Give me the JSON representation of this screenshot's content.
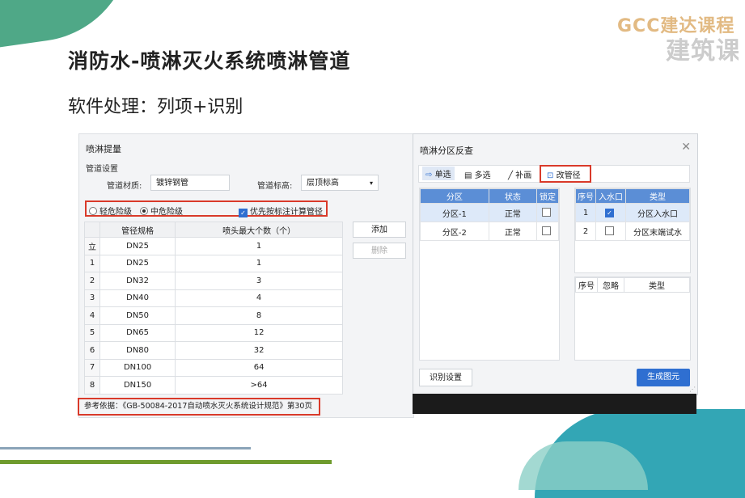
{
  "slide": {
    "title": "消防水-喷淋灭火系统喷淋管道",
    "subtitle": "软件处理：列项+识别",
    "logo_text": "GCC建达课程",
    "logo_sub": "建筑课程"
  },
  "left_dialog": {
    "title": "喷淋提量",
    "group_label": "管道设置",
    "material_label": "管道材质:",
    "material_value": "镀锌钢管",
    "elevation_label": "管道标高:",
    "elevation_value": "层顶标高",
    "hazard_light": "轻危险级",
    "hazard_medium": "中危险级",
    "priority_check": "优先按标注计算管径",
    "table_headers": [
      "管径规格",
      "喷头最大个数（个）"
    ],
    "rows": [
      {
        "idx": "立",
        "spec": "DN25",
        "count": "1"
      },
      {
        "idx": "1",
        "spec": "DN25",
        "count": "1"
      },
      {
        "idx": "2",
        "spec": "DN32",
        "count": "3"
      },
      {
        "idx": "3",
        "spec": "DN40",
        "count": "4"
      },
      {
        "idx": "4",
        "spec": "DN50",
        "count": "8"
      },
      {
        "idx": "5",
        "spec": "DN65",
        "count": "12"
      },
      {
        "idx": "6",
        "spec": "DN80",
        "count": "32"
      },
      {
        "idx": "7",
        "spec": "DN100",
        "count": "64"
      },
      {
        "idx": "8",
        "spec": "DN150",
        "count": ">64"
      }
    ],
    "add_button": "添加",
    "delete_button": "删除",
    "reference": "参考依据：《GB-50084-2017自动喷水灭火系统设计规范》第30页"
  },
  "right_dialog": {
    "title": "喷淋分区反查",
    "toolbar": {
      "single": "单选",
      "multi": "多选",
      "fill": "补画",
      "change_diameter": "改管径"
    },
    "zone_headers": [
      "分区",
      "状态",
      "锁定"
    ],
    "zones": [
      {
        "name": "分区-1",
        "status": "正常"
      },
      {
        "name": "分区-2",
        "status": "正常"
      }
    ],
    "inlet_headers": [
      "序号",
      "入水口",
      "类型"
    ],
    "inlets": [
      {
        "no": "1",
        "type": "分区入水口"
      },
      {
        "no": "2",
        "type": "分区末端试水"
      }
    ],
    "ignore_headers": [
      "序号",
      "忽略",
      "类型"
    ],
    "identify_button": "识别设置",
    "generate_button": "生成图元"
  },
  "colors": {
    "accent_blue": "#2f6fd1",
    "highlight_red": "#d93a2a",
    "header_blue": "#5b8ed6"
  }
}
